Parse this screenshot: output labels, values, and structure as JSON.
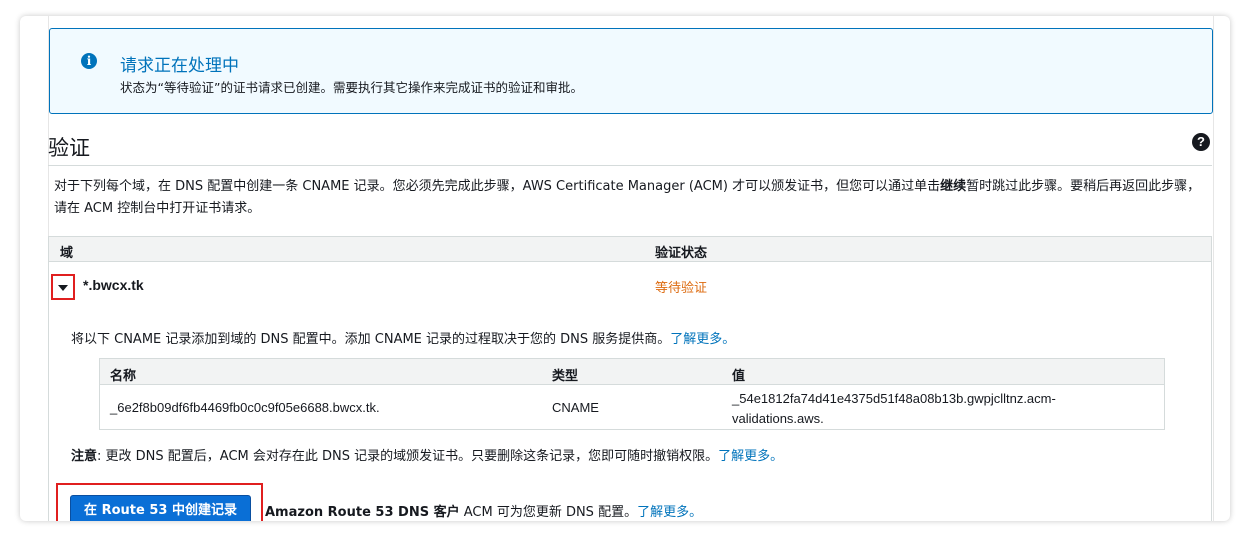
{
  "info": {
    "icon": "info-icon",
    "title": "请求正在处理中",
    "message": "状态为“等待验证”的证书请求已创建。需要执行其它操作来完成证书的验证和审批。"
  },
  "section": {
    "title": "验证",
    "help_icon": "question-circle-icon",
    "desc_part1": "对于下列每个域，在 DNS 配置中创建一条 CNAME 记录。您必须先完成此步骤，AWS Certificate Manager (ACM) 才可以颁发证书，但您可以通过单击",
    "desc_bold": "继续",
    "desc_part2": "暂时跳过此步骤。要稍后再返回此步骤，请在 ACM 控制台中打开证书请求。"
  },
  "table": {
    "col_domain": "域",
    "col_status": "验证状态",
    "row": {
      "domain": "*.bwcx.tk",
      "status": "等待验证",
      "status_color": "#dd6b10",
      "expanded": true
    }
  },
  "details": {
    "intro": "将以下 CNAME 记录添加到域的 DNS 配置中。添加 CNAME 记录的过程取决于您的 DNS 服务提供商。",
    "learn_more": "了解更多。",
    "record_headers": {
      "name": "名称",
      "type": "类型",
      "value": "值"
    },
    "record": {
      "name": "_6e2f8b09df6fb4469fb0c0c9f05e6688.bwcx.tk.",
      "type": "CNAME",
      "value": "_54e1812fa74d41e4375d51f48a08b13b.gwpjclltnz.acm-validations.aws."
    },
    "note_label": "注意",
    "note_text": ": 更改 DNS 配置后，ACM 会对存在此 DNS 记录的域颁发证书。只要删除这条记录，您即可随时撤销权限。",
    "route53_button": "在 Route 53 中创建记录",
    "route53_bold": "Amazon Route 53 DNS 客户",
    "route53_text": " ACM 可为您更新 DNS 配置。"
  },
  "colors": {
    "accent": "#0073bb",
    "warning": "#dd6b10",
    "highlight": "#e01f1f",
    "button": "#0a6fd6"
  }
}
